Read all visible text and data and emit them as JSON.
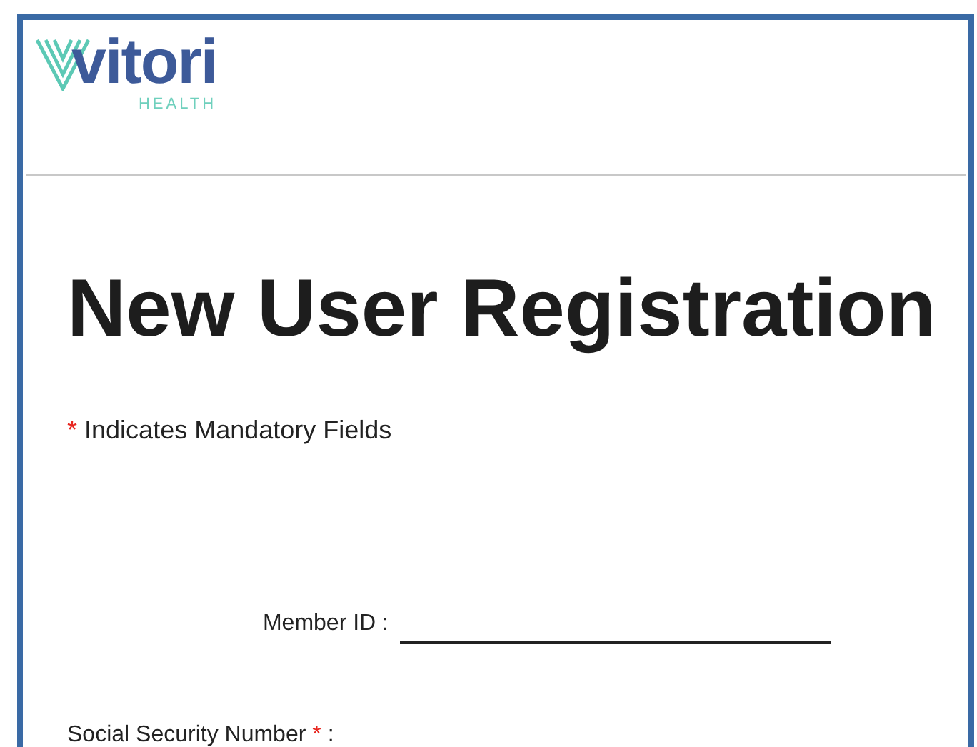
{
  "logo": {
    "name": "vitori",
    "tagline": "HEALTH"
  },
  "title": "New User Registration",
  "mandatory_note": {
    "mark": "*",
    "text": "Indicates Mandatory Fields"
  },
  "fields": [
    {
      "label": "Member ID",
      "separator": ":",
      "required": false,
      "kind": "input"
    },
    {
      "label": "Social Security Number",
      "separator": ":",
      "required": true,
      "kind": "label_only"
    }
  ]
}
